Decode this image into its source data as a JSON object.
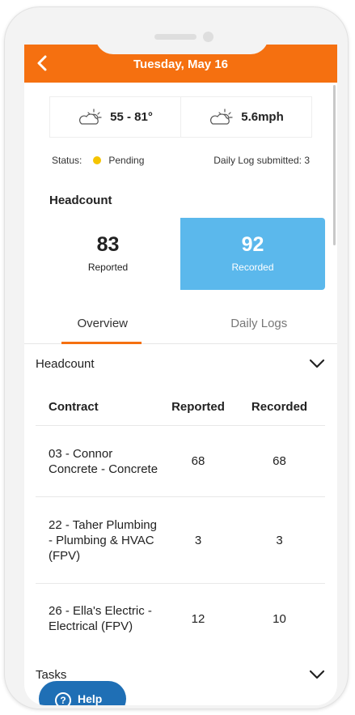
{
  "header": {
    "title": "Tuesday, May 16",
    "back_icon": "chevron-left-icon"
  },
  "weather": {
    "temp_range": "55 - 81°",
    "wind": "5.6mph",
    "icon": "partly-cloudy-icon"
  },
  "status": {
    "label": "Status:",
    "value": "Pending",
    "dot_color": "#f5c400",
    "submitted": "Daily Log submitted: 3"
  },
  "headcount": {
    "title": "Headcount",
    "reported_value": "83",
    "reported_label": "Reported",
    "recorded_value": "92",
    "recorded_label": "Recorded"
  },
  "tabs": [
    {
      "label": "Overview",
      "active": true
    },
    {
      "label": "Daily Logs",
      "active": false
    }
  ],
  "sections": {
    "headcount_label": "Headcount",
    "tasks_label": "Tasks"
  },
  "table": {
    "columns": [
      "Contract",
      "Reported",
      "Recorded"
    ],
    "rows": [
      {
        "contract": "03 - Connor Concrete - Concrete",
        "reported": "68",
        "recorded": "68"
      },
      {
        "contract": "22 - Taher Plumbing - Plumbing & HVAC (FPV)",
        "reported": "3",
        "recorded": "3"
      },
      {
        "contract": "26 - Ella's Electric - Electrical (FPV)",
        "reported": "12",
        "recorded": "10"
      }
    ]
  },
  "help": {
    "label": "Help",
    "icon": "question-circle-icon"
  },
  "colors": {
    "accent": "#f57010",
    "recorded": "#5bb8ec",
    "help": "#1f6fb5"
  }
}
